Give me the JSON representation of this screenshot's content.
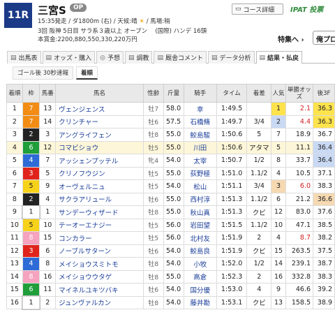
{
  "header": {
    "race_no": "11R",
    "race_name": "三宮S",
    "grade": "OP",
    "info1": "15:35発走 / ダ1800m (右) / 天候:晴",
    "baba": "/ 馬場:稍",
    "info2": "3回 阪神 5日目 サラ系３歳以上 オープン 　(国際) ハンデ 16頭",
    "info3": "本賞金:2200,880,550,330,220万円",
    "course_btn": "コース詳細",
    "ipat": "IPAT 投票",
    "special": "特集へ ›",
    "reserve": "俺プロ",
    "weather_icon": "sun-icon"
  },
  "tabs": [
    {
      "label": "出馬表",
      "icon": "▤"
    },
    {
      "label": "オッズ・購入",
      "icon": "▤"
    },
    {
      "label": "予想",
      "icon": "◎"
    },
    {
      "label": "調教",
      "icon": "▤"
    },
    {
      "label": "厩舎コメント",
      "icon": "▤"
    },
    {
      "label": "データ分析",
      "icon": "▤"
    },
    {
      "label": "結果・払戻",
      "icon": "▤"
    }
  ],
  "subtabs": [
    "ゴール後 30秒速報",
    "着順"
  ],
  "columns": [
    "着順",
    "枠",
    "馬番",
    "馬名",
    "性齢",
    "斤量",
    "騎手",
    "タイム",
    "着差",
    "人気",
    "単勝オッズ",
    "後3F"
  ],
  "rows": [
    {
      "rank": "1",
      "waku": "7",
      "num": "13",
      "name": "ヴェンジェンス",
      "sex": "牡7",
      "weight": "58.0",
      "jockey": "幸",
      "time": "1:49.5",
      "margin": "",
      "pop": "1",
      "odds": "2.1",
      "f3": "36.3"
    },
    {
      "rank": "2",
      "waku": "7",
      "num": "14",
      "name": "クリンチャー",
      "sex": "牡6",
      "weight": "57.5",
      "jockey": "石橋脩",
      "time": "1:49.7",
      "margin": "3/4",
      "pop": "2",
      "odds": "4.4",
      "f3": "36.3"
    },
    {
      "rank": "3",
      "waku": "2",
      "num": "3",
      "name": "アングライフェン",
      "sex": "牡8",
      "weight": "55.0",
      "jockey": "鮫島駿",
      "time": "1:50.6",
      "margin": "5",
      "pop": "7",
      "odds": "18.9",
      "f3": "36.7"
    },
    {
      "rank": "4",
      "waku": "6",
      "num": "12",
      "name": "コマビショウ",
      "sex": "牡5",
      "weight": "55.0",
      "jockey": "川田",
      "time": "1:50.6",
      "margin": "アタマ",
      "pop": "5",
      "odds": "11.1",
      "f3": "36.4"
    },
    {
      "rank": "5",
      "waku": "4",
      "num": "7",
      "name": "アッシェンプッテル",
      "sex": "牝4",
      "weight": "54.0",
      "jockey": "太宰",
      "time": "1:50.7",
      "margin": "1/2",
      "pop": "8",
      "odds": "33.7",
      "f3": "36.4"
    },
    {
      "rank": "6",
      "waku": "3",
      "num": "5",
      "name": "クリノフウジン",
      "sex": "牡5",
      "weight": "55.0",
      "jockey": "荻野極",
      "time": "1:51.0",
      "margin": "1.1/2",
      "pop": "4",
      "odds": "10.5",
      "f3": "37.1"
    },
    {
      "rank": "7",
      "waku": "5",
      "num": "9",
      "name": "オーヴェルニュ",
      "sex": "牡5",
      "weight": "54.0",
      "jockey": "松山",
      "time": "1:51.1",
      "margin": "3/4",
      "pop": "3",
      "odds": "6.0",
      "f3": "38.3"
    },
    {
      "rank": "8",
      "waku": "2",
      "num": "4",
      "name": "サクラアリュール",
      "sex": "牡6",
      "weight": "55.0",
      "jockey": "西村淳",
      "time": "1:51.3",
      "margin": "1.1/2",
      "pop": "6",
      "odds": "21.2",
      "f3": "36.6"
    },
    {
      "rank": "9",
      "waku": "1",
      "num": "1",
      "name": "サンデーウィザード",
      "sex": "牡8",
      "weight": "55.0",
      "jockey": "秋山真",
      "time": "1:51.3",
      "margin": "クビ",
      "pop": "12",
      "odds": "83.0",
      "f3": "37.6"
    },
    {
      "rank": "10",
      "waku": "5",
      "num": "10",
      "name": "テーオーエナジー",
      "sex": "牡5",
      "weight": "56.0",
      "jockey": "岩田望",
      "time": "1:51.5",
      "margin": "1.1/2",
      "pop": "10",
      "odds": "47.1",
      "f3": "38.5"
    },
    {
      "rank": "11",
      "waku": "8",
      "num": "15",
      "name": "コンカラー",
      "sex": "牡5",
      "weight": "56.0",
      "jockey": "北村友",
      "time": "1:51.9",
      "margin": "2",
      "pop": "4",
      "odds": "8.7",
      "f3": "38.2"
    },
    {
      "rank": "12",
      "waku": "3",
      "num": "6",
      "name": "ノーブルサターン",
      "sex": "牡6",
      "weight": "54.0",
      "jockey": "鮫島良",
      "time": "1:51.9",
      "margin": "クビ",
      "pop": "15",
      "odds": "263.5",
      "f3": "37.5"
    },
    {
      "rank": "13",
      "waku": "4",
      "num": "8",
      "name": "メイショウスミトモ",
      "sex": "牡8",
      "weight": "54.0",
      "jockey": "小牧",
      "time": "1:52.0",
      "margin": "1/2",
      "pop": "14",
      "odds": "239.1",
      "f3": "38.7"
    },
    {
      "rank": "14",
      "waku": "8",
      "num": "16",
      "name": "メイショウウタゲ",
      "sex": "牡8",
      "weight": "55.0",
      "jockey": "高倉",
      "time": "1:52.3",
      "margin": "2",
      "pop": "16",
      "odds": "332.8",
      "f3": "38.3"
    },
    {
      "rank": "15",
      "waku": "6",
      "num": "11",
      "name": "マイネルユキツバキ",
      "sex": "牡6",
      "weight": "54.0",
      "jockey": "国分優",
      "time": "1:53.0",
      "margin": "4",
      "pop": "9",
      "odds": "46.6",
      "f3": "39.2"
    },
    {
      "rank": "16",
      "waku": "1",
      "num": "2",
      "name": "ジュンヴァルカン",
      "sex": "牡8",
      "weight": "54.0",
      "jockey": "藤井勘",
      "time": "1:53.1",
      "margin": "クビ",
      "pop": "13",
      "odds": "158.5",
      "f3": "38.9"
    }
  ],
  "colors": {
    "w1": "#ffffff",
    "w2": "#222222",
    "w3": "#e0241b",
    "w4": "#2f6bd6",
    "w5": "#f7d21a",
    "w6": "#1f9e3a",
    "w7": "#f28c14",
    "w8": "#f5a3bf"
  }
}
